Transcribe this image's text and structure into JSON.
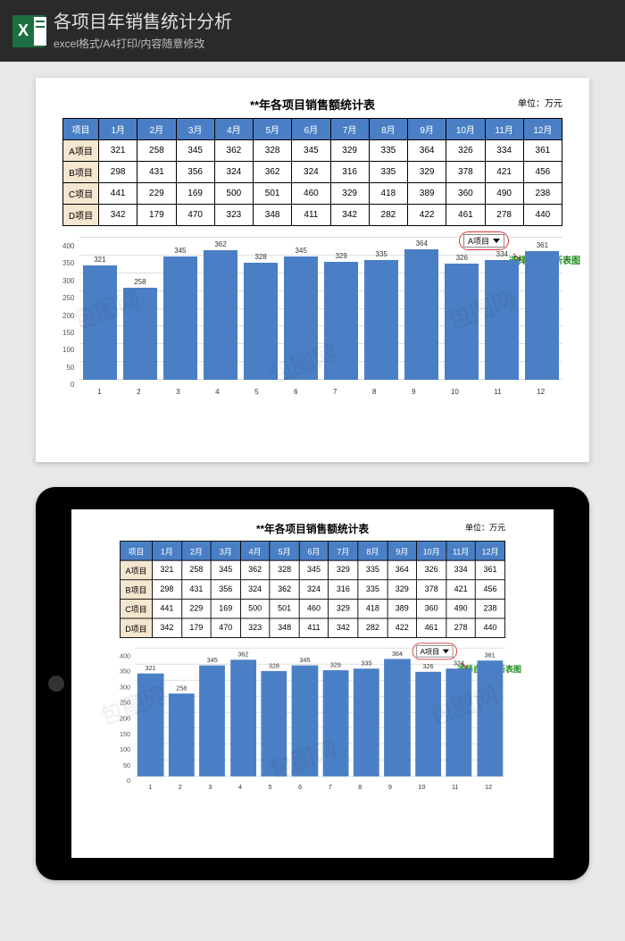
{
  "header": {
    "title": "各项目年销售统计分析",
    "subtitle": "excel格式/A4打印/内容随意修改",
    "icon_letter": "X"
  },
  "doc": {
    "title": "**年各项目销售额统计表",
    "unit": "单位：万元",
    "columns": [
      "项目",
      "1月",
      "2月",
      "3月",
      "4月",
      "5月",
      "6月",
      "7月",
      "8月",
      "9月",
      "10月",
      "11月",
      "12月"
    ],
    "rows": [
      {
        "name": "A项目",
        "v": [
          321,
          258,
          345,
          362,
          328,
          345,
          329,
          335,
          364,
          326,
          334,
          361
        ]
      },
      {
        "name": "B项目",
        "v": [
          298,
          431,
          356,
          324,
          362,
          324,
          316,
          335,
          329,
          378,
          421,
          456
        ]
      },
      {
        "name": "C项目",
        "v": [
          441,
          229,
          169,
          500,
          501,
          460,
          329,
          418,
          389,
          360,
          490,
          238
        ]
      },
      {
        "name": "D项目",
        "v": [
          342,
          179,
          470,
          323,
          348,
          411,
          342,
          282,
          422,
          461,
          278,
          440
        ]
      }
    ],
    "dropdown": {
      "label": "A项目"
    },
    "hint": "选择自动更新表图"
  },
  "chart_data": {
    "type": "bar",
    "categories": [
      1,
      2,
      3,
      4,
      5,
      6,
      7,
      8,
      9,
      10,
      11,
      12
    ],
    "values": [
      321,
      258,
      345,
      362,
      328,
      345,
      329,
      335,
      364,
      326,
      334,
      361
    ],
    "title": "",
    "xlabel": "",
    "ylabel": "",
    "ylim": [
      0,
      400
    ],
    "y_ticks": [
      0,
      50,
      100,
      150,
      200,
      250,
      300,
      350,
      400
    ]
  },
  "watermark": "包图网"
}
